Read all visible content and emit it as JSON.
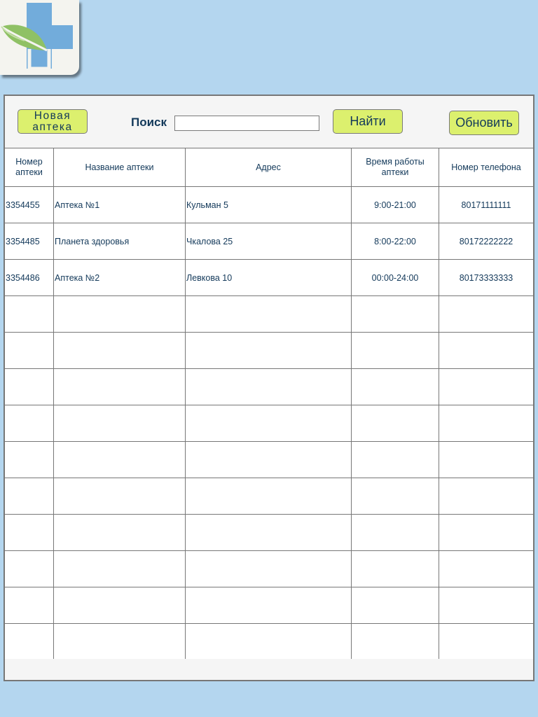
{
  "logo": {
    "icon": "pharmacy-cross-leaf-icon",
    "cross_color": "#72acdb",
    "leaf_color": "#8fc165"
  },
  "toolbar": {
    "new_button_label": "Новая аптека",
    "search_label": "Поиск",
    "search_value": "",
    "find_button_label": "Найти",
    "refresh_button_label": "Обновить"
  },
  "table": {
    "headers": [
      "Номер аптеки",
      "Название аптеки",
      "Адрес",
      "Время работы аптеки",
      "Номер телефона"
    ],
    "rows": [
      [
        "3354455",
        "Аптека №1",
        "Кульман 5",
        "9:00-21:00",
        "80171111111"
      ],
      [
        "3354485",
        "Планета здоровья",
        "Чкалова 25",
        "8:00-22:00",
        "80172222222"
      ],
      [
        "3354486",
        "Аптека №2",
        "Левкова 10",
        "00:00-24:00",
        "80173333333"
      ],
      [
        "",
        "",
        "",
        "",
        ""
      ],
      [
        "",
        "",
        "",
        "",
        ""
      ],
      [
        "",
        "",
        "",
        "",
        ""
      ],
      [
        "",
        "",
        "",
        "",
        ""
      ],
      [
        "",
        "",
        "",
        "",
        ""
      ],
      [
        "",
        "",
        "",
        "",
        ""
      ],
      [
        "",
        "",
        "",
        "",
        ""
      ],
      [
        "",
        "",
        "",
        "",
        ""
      ],
      [
        "",
        "",
        "",
        "",
        ""
      ],
      [
        "",
        "",
        "",
        "",
        ""
      ]
    ]
  },
  "colors": {
    "background": "#b4d6ef",
    "button": "#dcf06e",
    "text": "#13395a"
  }
}
